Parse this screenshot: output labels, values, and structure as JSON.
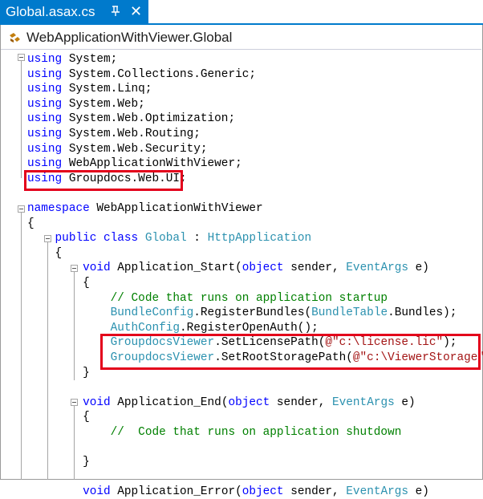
{
  "tab": {
    "title": "Global.asax.cs",
    "pin_icon": "pin-icon",
    "close_icon": "close-icon"
  },
  "navbar": {
    "class_name": "WebApplicationWithViewer.Global",
    "icon": "class-icon"
  },
  "editor": {
    "lines": [
      [
        {
          "t": "kw",
          "v": "using"
        },
        {
          "t": "pl",
          "v": " System;"
        }
      ],
      [
        {
          "t": "kw",
          "v": "using"
        },
        {
          "t": "pl",
          "v": " System.Collections.Generic;"
        }
      ],
      [
        {
          "t": "kw",
          "v": "using"
        },
        {
          "t": "pl",
          "v": " System.Linq;"
        }
      ],
      [
        {
          "t": "kw",
          "v": "using"
        },
        {
          "t": "pl",
          "v": " System.Web;"
        }
      ],
      [
        {
          "t": "kw",
          "v": "using"
        },
        {
          "t": "pl",
          "v": " System.Web.Optimization;"
        }
      ],
      [
        {
          "t": "kw",
          "v": "using"
        },
        {
          "t": "pl",
          "v": " System.Web.Routing;"
        }
      ],
      [
        {
          "t": "kw",
          "v": "using"
        },
        {
          "t": "pl",
          "v": " System.Web.Security;"
        }
      ],
      [
        {
          "t": "kw",
          "v": "using"
        },
        {
          "t": "pl",
          "v": " WebApplicationWithViewer;"
        }
      ],
      [
        {
          "t": "kw",
          "v": "using"
        },
        {
          "t": "pl",
          "v": " Groupdocs.Web.UI;"
        }
      ],
      [],
      [
        {
          "t": "kw",
          "v": "namespace"
        },
        {
          "t": "pl",
          "v": " WebApplicationWithViewer"
        }
      ],
      [
        {
          "t": "pl",
          "v": "{"
        }
      ],
      [
        {
          "t": "pl",
          "v": "    "
        },
        {
          "t": "kw",
          "v": "public"
        },
        {
          "t": "pl",
          "v": " "
        },
        {
          "t": "kw",
          "v": "class"
        },
        {
          "t": "pl",
          "v": " "
        },
        {
          "t": "ty",
          "v": "Global"
        },
        {
          "t": "pl",
          "v": " : "
        },
        {
          "t": "ty",
          "v": "HttpApplication"
        }
      ],
      [
        {
          "t": "pl",
          "v": "    {"
        }
      ],
      [
        {
          "t": "pl",
          "v": "        "
        },
        {
          "t": "kw",
          "v": "void"
        },
        {
          "t": "pl",
          "v": " Application_Start("
        },
        {
          "t": "kw",
          "v": "object"
        },
        {
          "t": "pl",
          "v": " sender, "
        },
        {
          "t": "ty",
          "v": "EventArgs"
        },
        {
          "t": "pl",
          "v": " e)"
        }
      ],
      [
        {
          "t": "pl",
          "v": "        {"
        }
      ],
      [
        {
          "t": "pl",
          "v": "            "
        },
        {
          "t": "cm",
          "v": "// Code that runs on application startup"
        }
      ],
      [
        {
          "t": "pl",
          "v": "            "
        },
        {
          "t": "ty",
          "v": "BundleConfig"
        },
        {
          "t": "pl",
          "v": ".RegisterBundles("
        },
        {
          "t": "ty",
          "v": "BundleTable"
        },
        {
          "t": "pl",
          "v": ".Bundles);"
        }
      ],
      [
        {
          "t": "pl",
          "v": "            "
        },
        {
          "t": "ty",
          "v": "AuthConfig"
        },
        {
          "t": "pl",
          "v": ".RegisterOpenAuth();"
        }
      ],
      [
        {
          "t": "pl",
          "v": "            "
        },
        {
          "t": "ty",
          "v": "GroupdocsViewer"
        },
        {
          "t": "pl",
          "v": ".SetLicensePath("
        },
        {
          "t": "st",
          "v": "@\"c:\\license.lic\""
        },
        {
          "t": "pl",
          "v": ");"
        }
      ],
      [
        {
          "t": "pl",
          "v": "            "
        },
        {
          "t": "ty",
          "v": "GroupdocsViewer"
        },
        {
          "t": "pl",
          "v": ".SetRootStoragePath("
        },
        {
          "t": "st",
          "v": "@\"c:\\ViewerStorage\""
        },
        {
          "t": "pl",
          "v": ");"
        }
      ],
      [
        {
          "t": "pl",
          "v": "        }"
        }
      ],
      [],
      [
        {
          "t": "pl",
          "v": "        "
        },
        {
          "t": "kw",
          "v": "void"
        },
        {
          "t": "pl",
          "v": " Application_End("
        },
        {
          "t": "kw",
          "v": "object"
        },
        {
          "t": "pl",
          "v": " sender, "
        },
        {
          "t": "ty",
          "v": "EventArgs"
        },
        {
          "t": "pl",
          "v": " e)"
        }
      ],
      [
        {
          "t": "pl",
          "v": "        {"
        }
      ],
      [
        {
          "t": "pl",
          "v": "            "
        },
        {
          "t": "cm",
          "v": "//  Code that runs on application shutdown"
        }
      ],
      [],
      [
        {
          "t": "pl",
          "v": "        }"
        }
      ],
      [],
      [
        {
          "t": "pl",
          "v": "        "
        },
        {
          "t": "kw",
          "v": "void"
        },
        {
          "t": "pl",
          "v": " Application_Error("
        },
        {
          "t": "kw",
          "v": "object"
        },
        {
          "t": "pl",
          "v": " sender, "
        },
        {
          "t": "ty",
          "v": "EventArgs"
        },
        {
          "t": "pl",
          "v": " e)"
        }
      ]
    ]
  },
  "colors": {
    "tab_bg": "#007acc",
    "keyword": "#0000ff",
    "type": "#2b91af",
    "comment": "#008000",
    "string": "#a31515",
    "highlight_box": "#e3001b"
  }
}
